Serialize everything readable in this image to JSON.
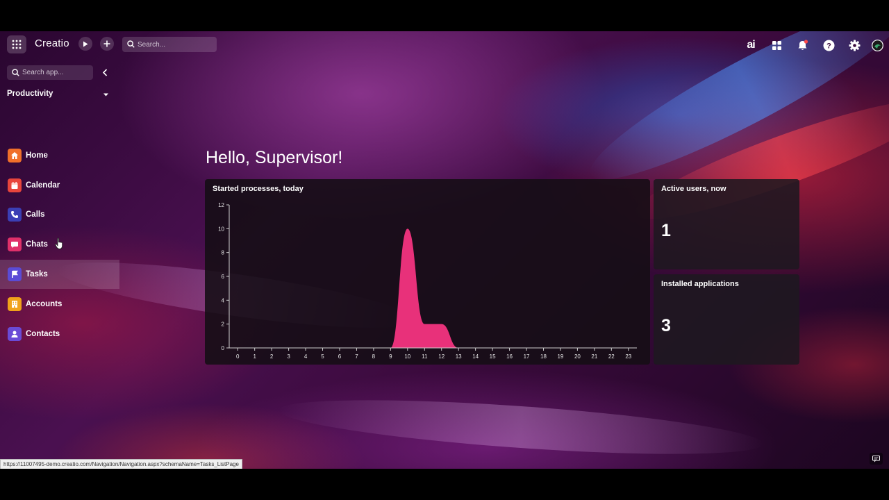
{
  "topbar": {
    "logo": "Creatio",
    "search_placeholder": "Search...",
    "ai_label": "ai",
    "notification_dot_color": "#ff4a4a"
  },
  "sidebar": {
    "search_placeholder": "Search app...",
    "section": "Productivity",
    "items": [
      {
        "label": "Home",
        "icon": "home-icon",
        "color": "#f0702a"
      },
      {
        "label": "Calendar",
        "icon": "calendar-icon",
        "color": "#e8453c"
      },
      {
        "label": "Calls",
        "icon": "phone-icon",
        "color": "#3b3fb5"
      },
      {
        "label": "Chats",
        "icon": "chat-icon",
        "color": "#e0306a"
      },
      {
        "label": "Tasks",
        "icon": "flag-icon",
        "color": "#5a4bd6",
        "active": true
      },
      {
        "label": "Accounts",
        "icon": "building-icon",
        "color": "#f0a21a"
      },
      {
        "label": "Contacts",
        "icon": "person-icon",
        "color": "#6a4bd6"
      }
    ]
  },
  "main": {
    "greeting": "Hello, Supervisor!",
    "chart_card": {
      "title": "Started processes, today"
    },
    "active_users": {
      "title": "Active users, now",
      "value": "1"
    },
    "installed_apps": {
      "title": "Installed applications",
      "value": "3"
    }
  },
  "status_bar": {
    "url": "https://11007495-demo.creatio.com/Navigation/Navigation.aspx?schemaName=Tasks_ListPage"
  },
  "chart_data": {
    "type": "area",
    "title": "Started processes, today",
    "x": [
      0,
      1,
      2,
      3,
      4,
      5,
      6,
      7,
      8,
      9,
      10,
      11,
      12,
      13,
      14,
      15,
      16,
      17,
      18,
      19,
      20,
      21,
      22,
      23
    ],
    "y": [
      0,
      0,
      0,
      0,
      0,
      0,
      0,
      0,
      0,
      0,
      10,
      2,
      2,
      0,
      0,
      0,
      0,
      0,
      0,
      0,
      0,
      0,
      0,
      0
    ],
    "xlim": [
      0,
      23
    ],
    "ylim": [
      0,
      12
    ],
    "yticks": [
      0,
      2,
      4,
      6,
      8,
      10,
      12
    ],
    "color": "#e8317a",
    "grid": false
  }
}
